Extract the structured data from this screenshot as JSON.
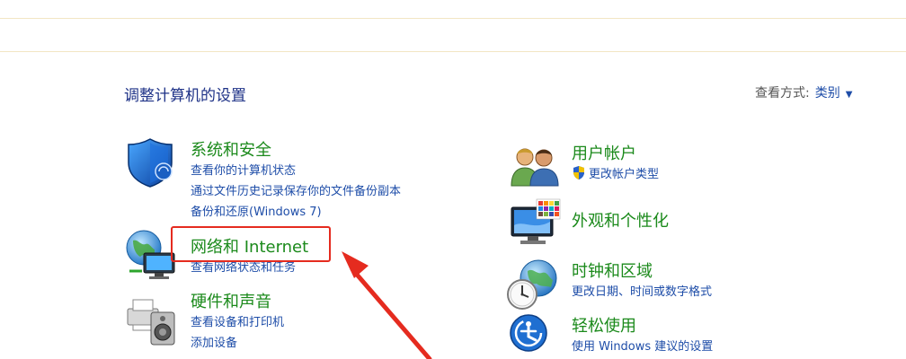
{
  "header": {
    "title": "调整计算机的设置",
    "view_by_label": "查看方式:",
    "view_by_value": "类别"
  },
  "left_categories": [
    {
      "title": "系统和安全",
      "icon": "shield-icon",
      "links": [
        "查看你的计算机状态",
        "通过文件历史记录保存你的文件备份副本",
        "备份和还原(Windows 7)"
      ]
    },
    {
      "title": "网络和 Internet",
      "icon": "network-globe-icon",
      "links": [
        "查看网络状态和任务"
      ]
    },
    {
      "title": "硬件和声音",
      "icon": "printer-speaker-icon",
      "links": [
        "查看设备和打印机",
        "添加设备"
      ]
    }
  ],
  "right_categories": [
    {
      "title": "用户帐户",
      "icon": "users-icon",
      "links": [
        "更改帐户类型"
      ]
    },
    {
      "title": "外观和个性化",
      "icon": "monitor-palette-icon",
      "links": []
    },
    {
      "title": "时钟和区域",
      "icon": "clock-globe-icon",
      "links": [
        "更改日期、时间或数字格式"
      ]
    },
    {
      "title": "轻松使用",
      "icon": "ease-of-access-icon",
      "links": [
        "使用 Windows 建议的设置"
      ]
    }
  ],
  "colors": {
    "category_title": "#1b8a1b",
    "link": "#1e4da8",
    "heading": "#1e3287",
    "annotation": "#e52b1f"
  }
}
